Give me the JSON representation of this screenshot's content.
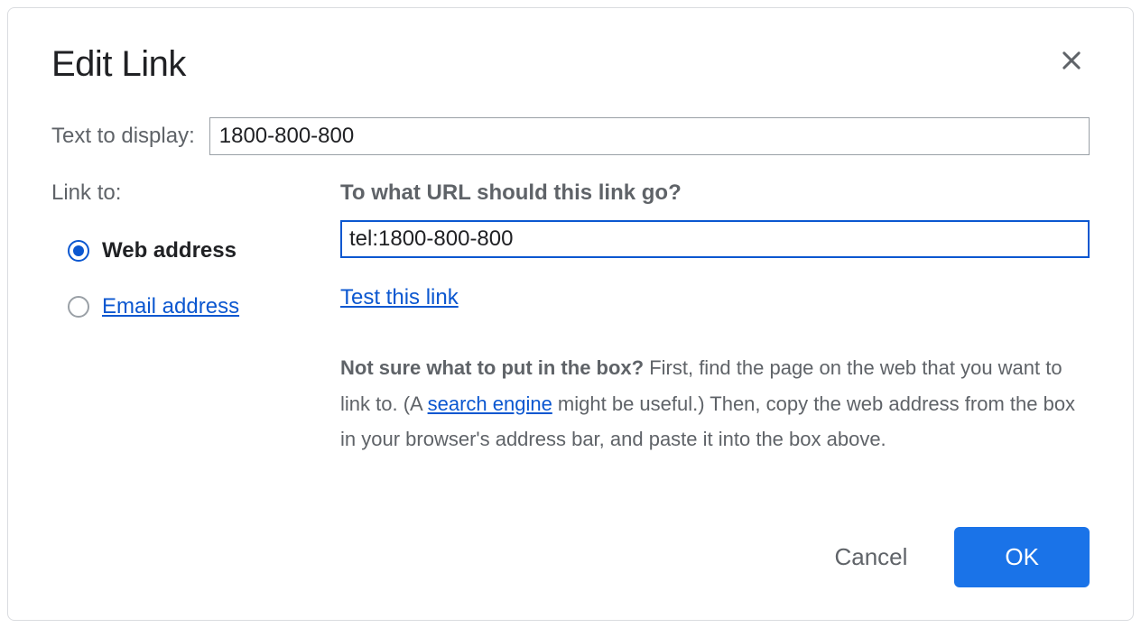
{
  "dialog": {
    "title": "Edit Link",
    "text_to_display_label": "Text to display:",
    "text_to_display_value": "1800-800-800",
    "link_to_label": "Link to:",
    "radio_options": {
      "web_address": "Web address",
      "email_address": "Email address"
    },
    "url_section": {
      "question": "To what URL should this link go?",
      "value": "tel:1800-800-800",
      "test_link_label": "Test this link"
    },
    "help": {
      "bold_part": "Not sure what to put in the box?",
      "part1": " First, find the page on the web that you want to link to. (A ",
      "search_engine_link": "search engine",
      "part2": " might be useful.) Then, copy the web address from the box in your browser's address bar, and paste it into the box above."
    },
    "buttons": {
      "cancel": "Cancel",
      "ok": "OK"
    }
  }
}
